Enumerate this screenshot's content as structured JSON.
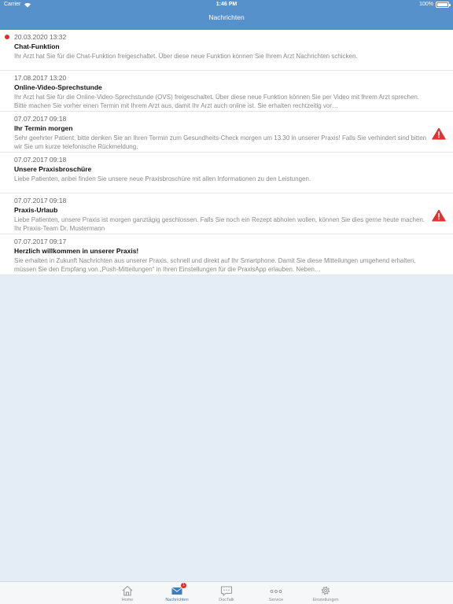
{
  "status": {
    "carrier": "Carrier",
    "time": "1:46 PM",
    "battery": "100%"
  },
  "header": {
    "title": "Nachrichten"
  },
  "messages": [
    {
      "date": "20.03.2020 13:32",
      "title": "Chat-Funktion",
      "text": "Ihr Arzt hat Sie für die Chat-Funktion freigeschaltet. Über diese neue Funktion können Sie Ihrem Arzt Nachrichten schicken."
    },
    {
      "date": "17.08.2017 13:20",
      "title": "Online-Video-Sprechstunde",
      "text": "Ihr Arzt hat Sie für die Online-Video-Sprechstunde (OVS) freigeschaltet. Über diese neue Funktion können Sie per Video mit Ihrem Arzt sprechen. Bitte machen Sie vorher einen Termin mit Ihrem Arzt aus, damit Ihr Arzt auch online ist. Sie erhalten rechtzeitig vor…"
    },
    {
      "date": "07.07.2017 09:18",
      "title": "Ihr Termin morgen",
      "text": "Sehr geehrter Patient, bitte denken Sie an Ihren Termin zum Gesundheits-Check morgen um 13.30 in unserer Praxis! Falls Sie verhindert sind bitten wir Sie um kurze telefonische Rückmeldung."
    },
    {
      "date": "07.07.2017 09:18",
      "title": "Unsere Praxisbroschüre",
      "text": "Liebe Patienten, anbei finden Sie unsere neue Praxisbroschüre mit allen Informationen zu den Leistungen."
    },
    {
      "date": "07.07.2017 09:18",
      "title": "Praxis-Urlaub",
      "text": "Liebe Patienten, unsere Praxis ist morgen ganztägig geschlossen. Falls Sie noch ein Rezept abholen wollen, können Sie dies gerne heute machen. Ihr Praxis-Team Dr. Mustermann"
    },
    {
      "date": "07.07.2017 09:17",
      "title": "Herzlich willkommen in unserer Praxis!",
      "text": "Sie erhalten in Zukunft Nachrichten aus unserer Praxis, schnell und direkt auf Ihr Smartphone. Damit Sie diese Mitteilungen umgehend erhalten, müssen Sie den Empfang von „Push-Mitteilungen“ in Ihren Einstellungen für die PraxisApp erlauben. Neben…"
    }
  ],
  "tabs": [
    {
      "label": "Home",
      "icon": "house-icon"
    },
    {
      "label": "Nachrichten",
      "icon": "envelope-icon",
      "badge": "1"
    },
    {
      "label": "DocTalk",
      "icon": "chat-bubble-icon"
    },
    {
      "label": "Service",
      "icon": "dots-icon"
    },
    {
      "label": "Einstellungen",
      "icon": "gear-icon"
    }
  ],
  "colors": {
    "accent": "#5691cb",
    "unread": "#e02d2d",
    "warning": "#e03434",
    "background": "#e4edf6"
  }
}
